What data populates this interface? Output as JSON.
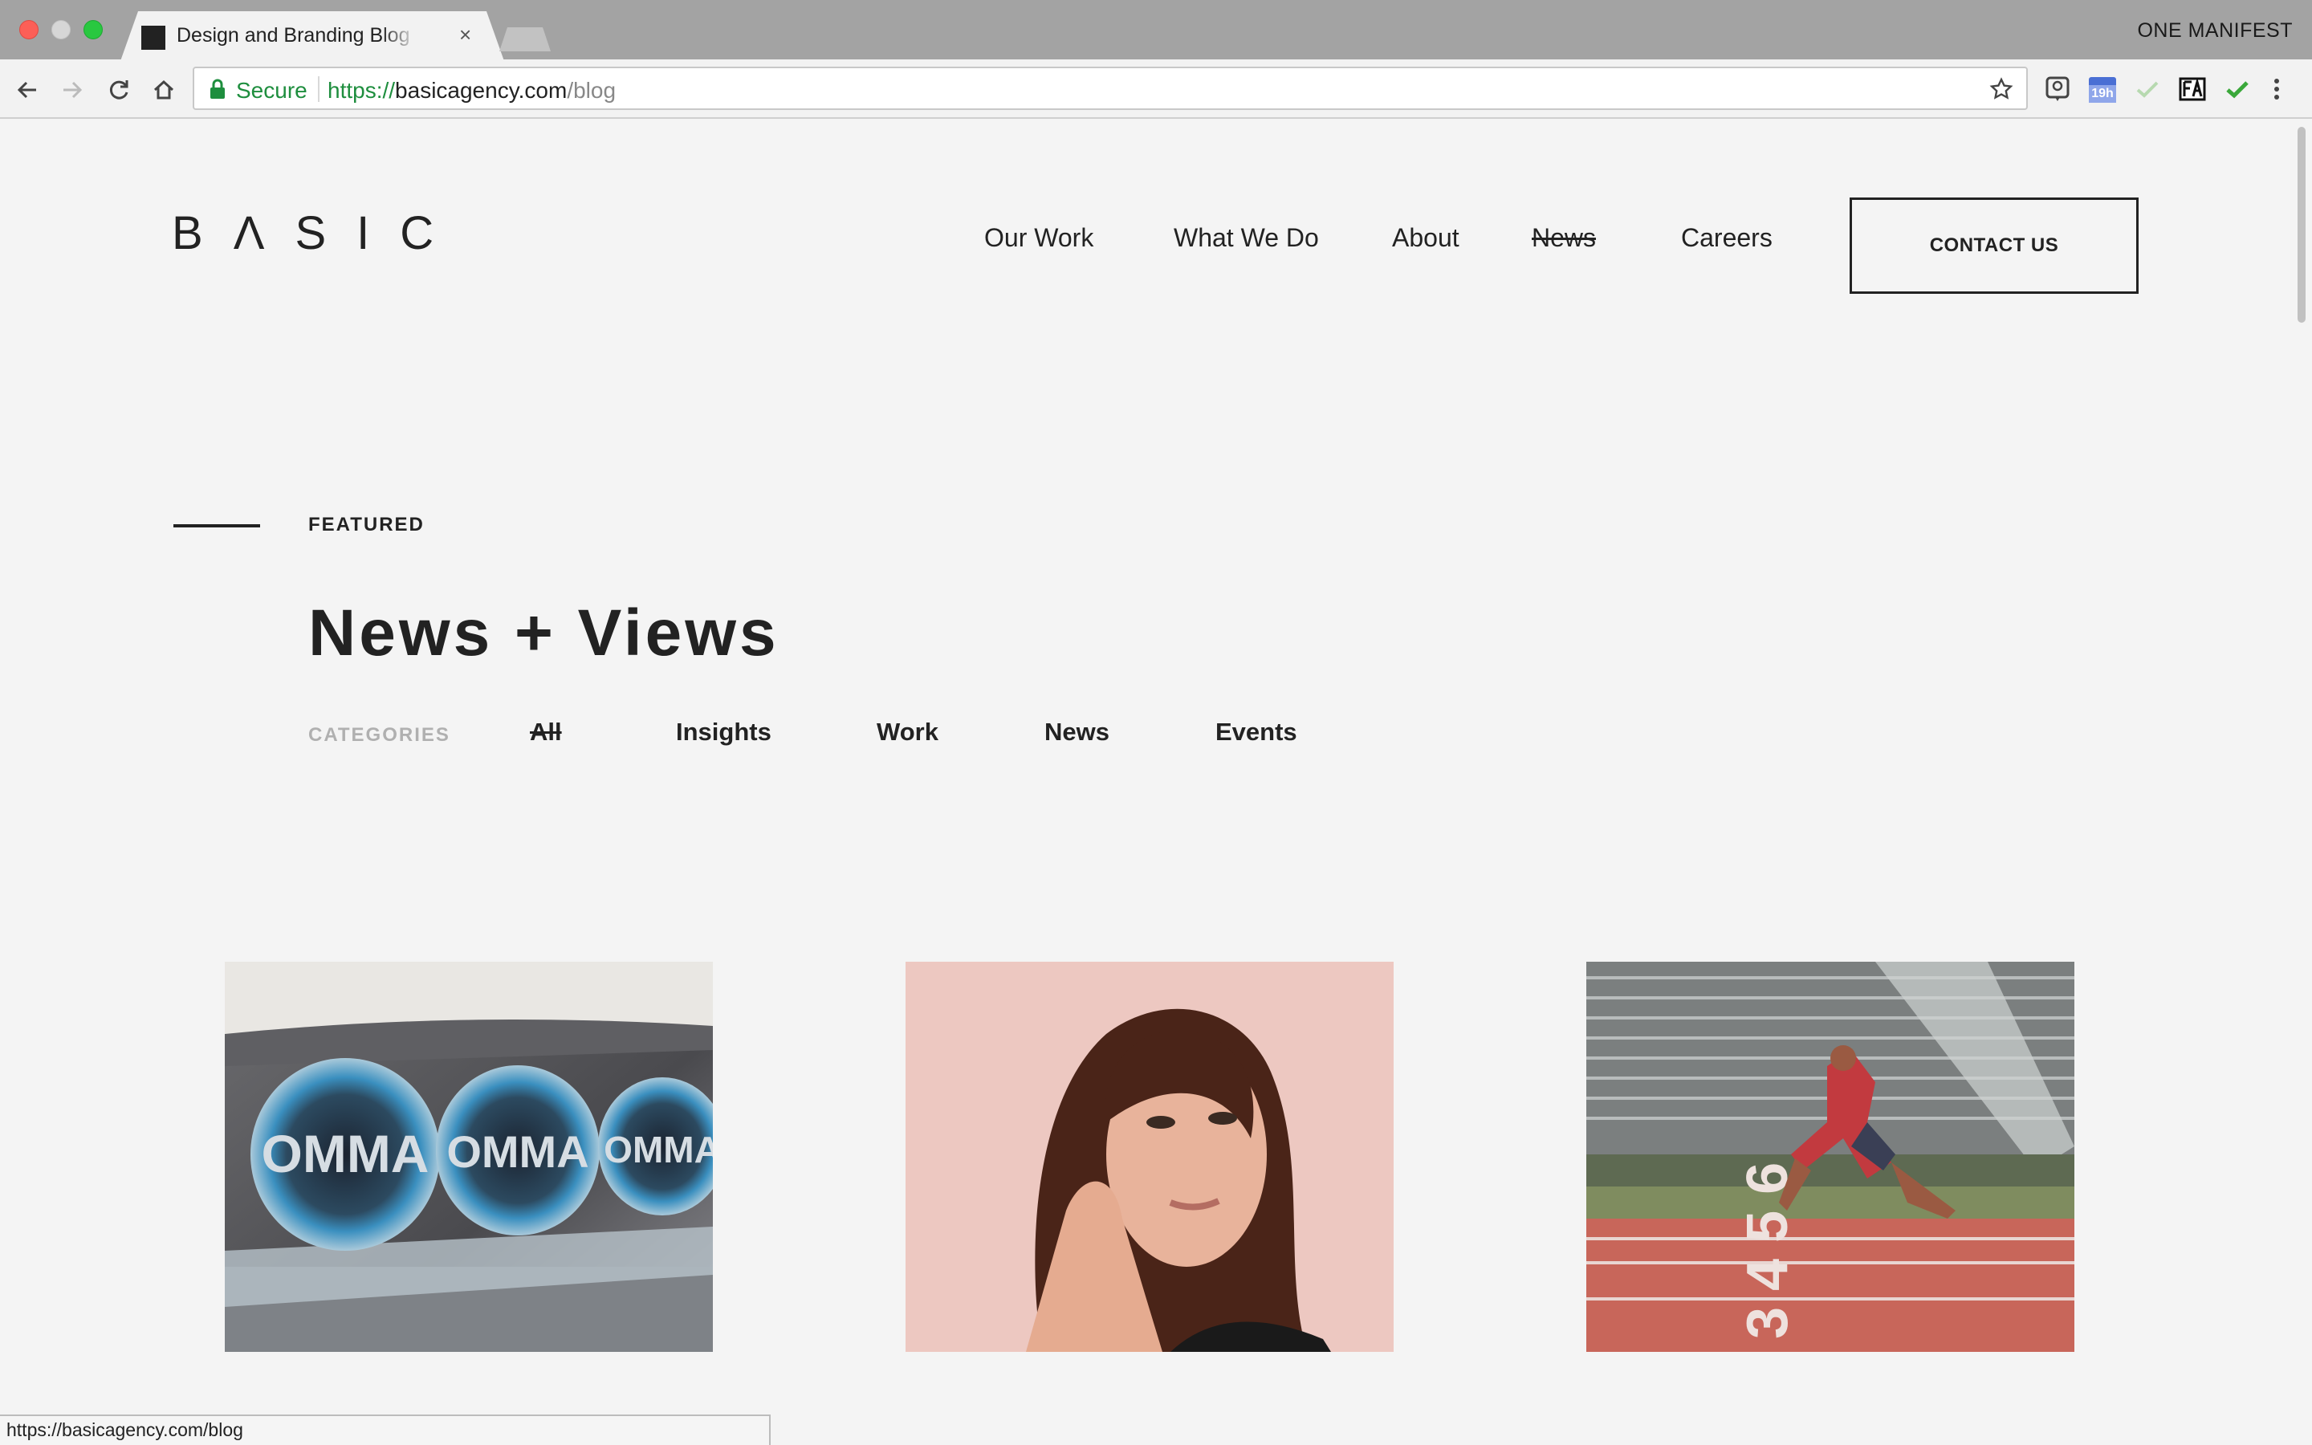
{
  "browser": {
    "tab_title": "Design and Branding Blog | BASIC",
    "tab_close": "×",
    "profile_name": "ONE MANIFEST",
    "secure_label": "Secure",
    "url_scheme": "https://",
    "url_host": "basicagency.com",
    "url_path": "/blog",
    "extensions": [
      "lightbulb-icon",
      "calendar-icon",
      "check-gray-icon",
      "fa-icon",
      "check-green-icon"
    ],
    "calendar_badge": "19h",
    "status_url": "https://basicagency.com/blog"
  },
  "site": {
    "logo_letters": [
      "B",
      "Λ",
      "S",
      "I",
      "C"
    ],
    "nav": [
      {
        "label": "Our Work",
        "active": false
      },
      {
        "label": "What We Do",
        "active": false
      },
      {
        "label": "About",
        "active": false
      },
      {
        "label": "News",
        "active": true
      },
      {
        "label": "Careers",
        "active": false
      }
    ],
    "contact_label": "CONTACT US"
  },
  "featured": {
    "label": "FEATURED",
    "title": "News + Views",
    "categories_label": "CATEGORIES",
    "categories": [
      {
        "label": "All",
        "active": true
      },
      {
        "label": "Insights",
        "active": false
      },
      {
        "label": "Work",
        "active": false
      },
      {
        "label": "News",
        "active": false
      },
      {
        "label": "Events",
        "active": false
      }
    ]
  },
  "cards": [
    {
      "image": "omma-awards-photo",
      "trophy_text": "OMMA"
    },
    {
      "image": "woman-portrait-photo"
    },
    {
      "image": "sprinter-track-photo",
      "lane_numbers": "3 4 5 6"
    }
  ],
  "colors": {
    "accent_green": "#1e8e3e",
    "page_bg": "#f4f4f4",
    "text": "#222222"
  }
}
